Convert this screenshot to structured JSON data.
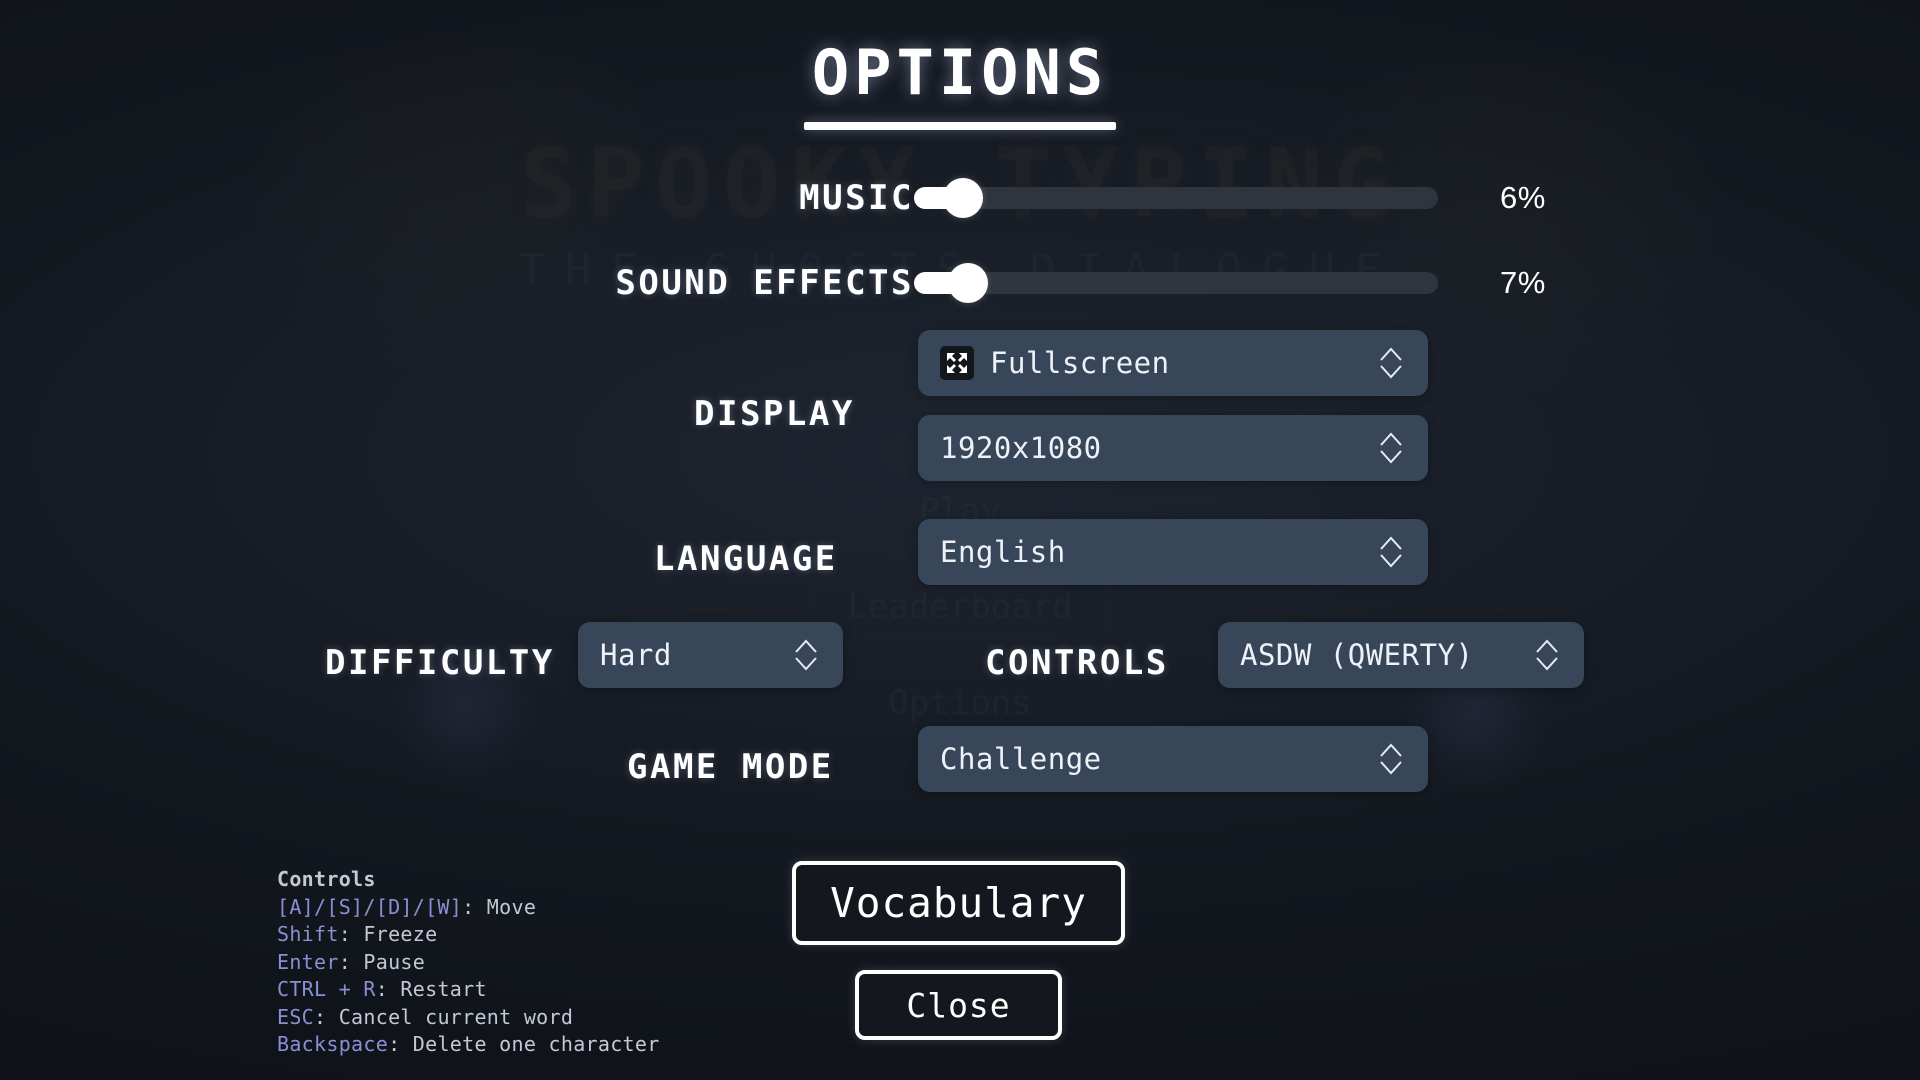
{
  "background": {
    "game_title": "SPOOKY TYPING",
    "game_subtitle": "THE GHOSTS DIALOGUE",
    "menu": [
      {
        "label": "Play"
      },
      {
        "label": "Leaderboard"
      },
      {
        "label": "Options"
      }
    ]
  },
  "header": {
    "title": "OPTIONS"
  },
  "sliders": [
    {
      "label": "MUSIC",
      "value": 6,
      "display": "6%",
      "min": 0,
      "max": 100
    },
    {
      "label": "SOUND EFFECTS",
      "value": 7,
      "display": "7%",
      "min": 0,
      "max": 100
    }
  ],
  "settings": {
    "display": {
      "label": "DISPLAY",
      "window_mode": {
        "value": "Fullscreen",
        "icon": "fullscreen-expand-icon"
      },
      "resolution": {
        "value": "1920x1080"
      }
    },
    "language": {
      "label": "LANGUAGE",
      "value": "English"
    },
    "difficulty": {
      "label": "DIFFICULTY",
      "value": "Hard"
    },
    "controls": {
      "label": "CONTROLS",
      "value": "ASDW (QWERTY)"
    },
    "game_mode": {
      "label": "GAME MODE",
      "value": "Challenge"
    }
  },
  "help": {
    "title": "Controls",
    "lines": [
      {
        "key": "[A]/[S]/[D]/[W]",
        "desc": ": Move"
      },
      {
        "key": "Shift",
        "desc": ": Freeze"
      },
      {
        "key": "Enter",
        "desc": ": Pause"
      },
      {
        "key": "CTRL + R",
        "desc": ": Restart"
      },
      {
        "key": "ESC",
        "desc": ": Cancel current word"
      },
      {
        "key": "Backspace",
        "desc": ": Delete one character"
      }
    ]
  },
  "buttons": {
    "vocabulary": "Vocabulary",
    "close": "Close"
  },
  "colors": {
    "page_bg": "#12161d",
    "select_bg": "#374659",
    "slider_track": "#2f343d",
    "slider_fill": "#ffffff",
    "accent_text": "#ffffff",
    "help_key": "#8a8fd3",
    "help_desc": "#c3c9d4"
  }
}
